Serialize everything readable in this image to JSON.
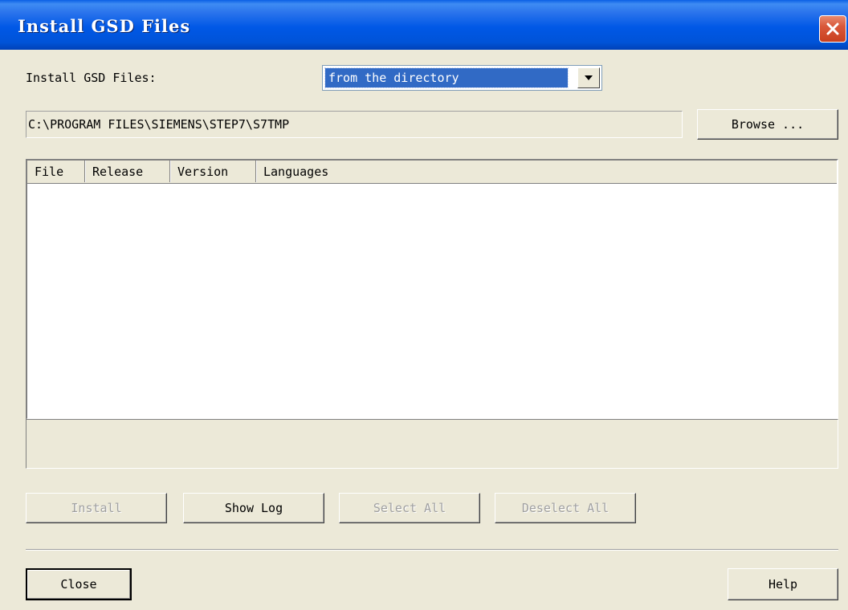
{
  "window": {
    "title": "Install GSD Files"
  },
  "source": {
    "label": "Install GSD Files:",
    "selected": "from the directory",
    "path": "C:\\PROGRAM FILES\\SIEMENS\\STEP7\\S7TMP",
    "browse_label": "Browse ..."
  },
  "list": {
    "columns": [
      "File",
      "Release",
      "Version",
      "Languages"
    ],
    "rows": []
  },
  "actions": {
    "install_label": "Install",
    "show_log_label": "Show Log",
    "select_all_label": "Select All",
    "deselect_all_label": "Deselect All"
  },
  "footer": {
    "close_label": "Close",
    "help_label": "Help"
  },
  "colors": {
    "titlebar": "#0054E3",
    "dialog_bg": "#ECE9D8",
    "selection": "#316AC5",
    "close_button": "#D9583A"
  },
  "icons": {
    "close": "close-x-icon",
    "dropdown": "chevron-down-icon"
  }
}
